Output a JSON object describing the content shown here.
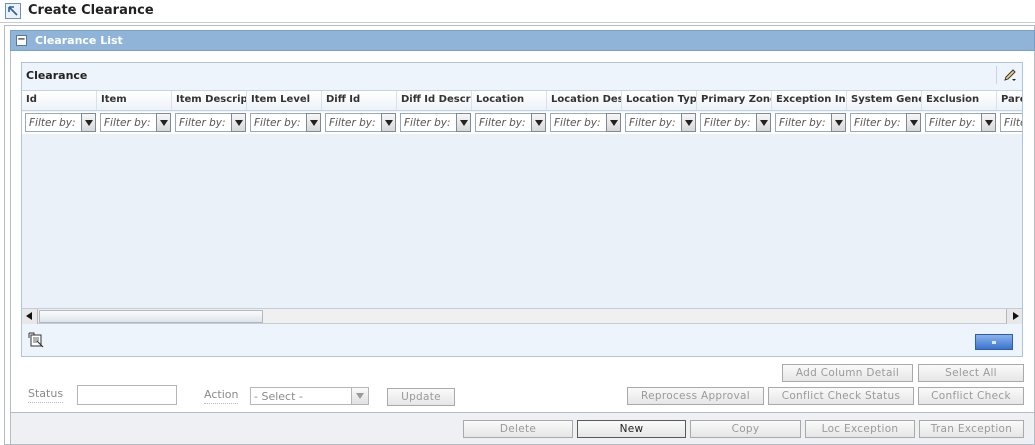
{
  "page": {
    "title": "Create Clearance"
  },
  "panel": {
    "title": "Clearance List",
    "collapse_glyph": "−"
  },
  "table": {
    "heading": "Clearance",
    "columns": [
      "Id",
      "Item",
      "Item Description",
      "Item Level",
      "Diff Id",
      "Diff Id Description",
      "Location",
      "Location Description",
      "Location Type",
      "Primary Zone",
      "Exception Indicator",
      "System Generated",
      "Exclusion",
      "Parent"
    ],
    "filter_placeholder": "Filter by:"
  },
  "form": {
    "status_label": "Status",
    "status_value": "",
    "action_label": "Action",
    "action_selected": "- Select -",
    "update_label": "Update"
  },
  "buttons": {
    "add_column_detail": "Add Column Detail",
    "select_all": "Select All",
    "reprocess_approval": "Reprocess Approval",
    "conflict_check_status": "Conflict Check Status",
    "conflict_check": "Conflict Check",
    "delete": "Delete",
    "new": "New",
    "copy": "Copy",
    "loc_exception": "Loc Exception",
    "tran_exception": "Tran Exception"
  },
  "colors": {
    "panel_header": "#8fb4d8",
    "grid_body": "#eaf1f9",
    "footer_button": "#3d74cf"
  },
  "icons": {
    "title": "window-restore-icon",
    "collapse": "collapse-icon",
    "pencil": "pencil-icon",
    "detach": "detach-icon",
    "scroll_left": "arrow-left-icon",
    "scroll_right": "arrow-right-icon",
    "dropdown": "chevron-down-icon"
  }
}
